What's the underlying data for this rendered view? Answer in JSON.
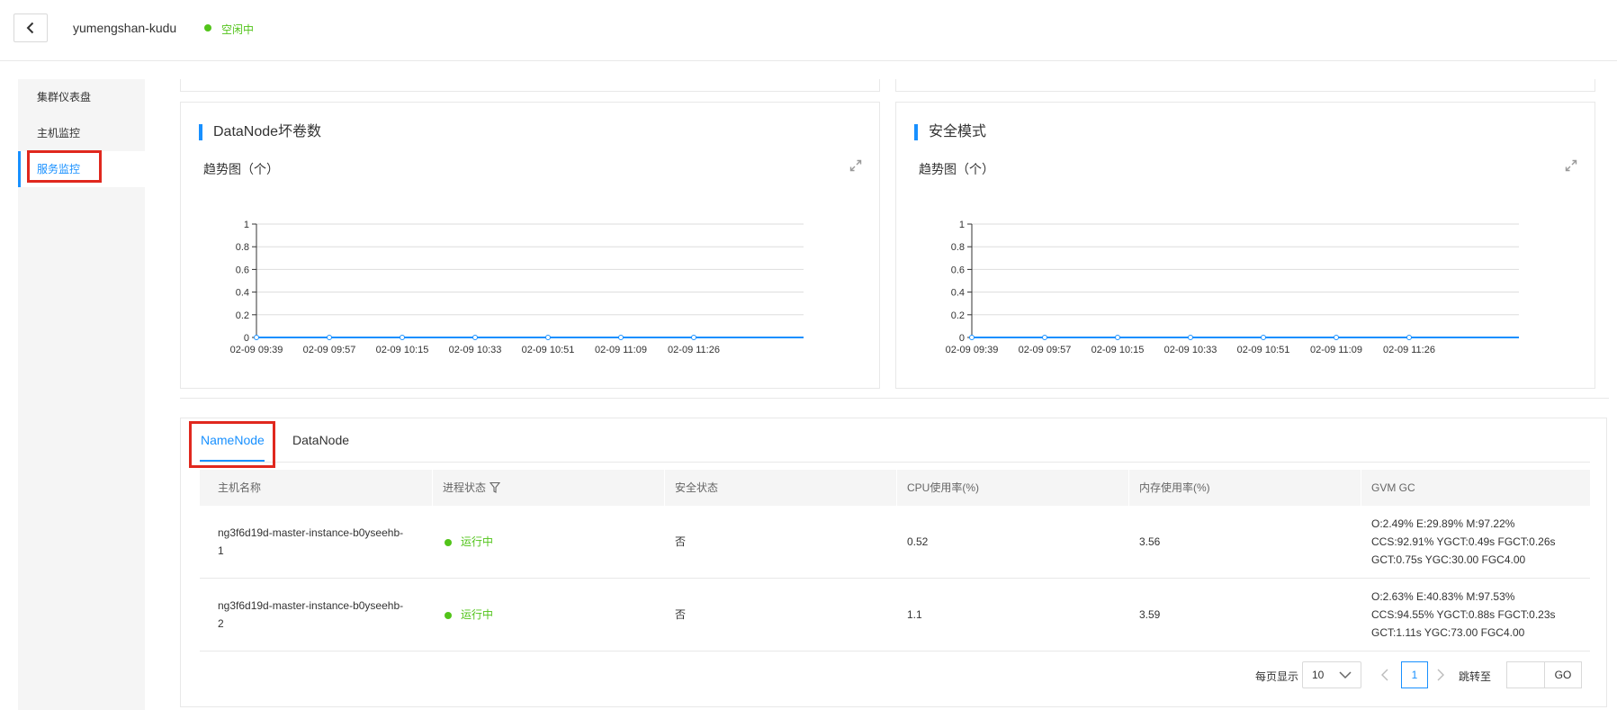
{
  "header": {
    "cluster_name": "yumengshan-kudu",
    "status": "空闲中",
    "status_color": "#52c41a"
  },
  "sidebar": {
    "items": [
      {
        "label": "集群仪表盘"
      },
      {
        "label": "主机监控"
      },
      {
        "label": "服务监控",
        "active": true
      }
    ]
  },
  "panels": [
    {
      "title": "DataNode坏卷数",
      "subtitle": "趋势图（个）"
    },
    {
      "title": "安全模式",
      "subtitle": "趋势图（个）"
    }
  ],
  "chart_data": [
    {
      "type": "line",
      "title": "DataNode坏卷数",
      "x": [
        "02-09 09:39",
        "02-09 09:57",
        "02-09 10:15",
        "02-09 10:33",
        "02-09 10:51",
        "02-09 11:09",
        "02-09 11:26"
      ],
      "series": [
        {
          "values": [
            0,
            0,
            0,
            0,
            0,
            0,
            0
          ]
        }
      ],
      "yticks": [
        "0",
        "0.2",
        "0.4",
        "0.6",
        "0.8",
        "1"
      ],
      "ylim": [
        0,
        1
      ],
      "grid": true,
      "color": "#1890ff"
    },
    {
      "type": "line",
      "title": "安全模式",
      "x": [
        "02-09 09:39",
        "02-09 09:57",
        "02-09 10:15",
        "02-09 10:33",
        "02-09 10:51",
        "02-09 11:09",
        "02-09 11:26"
      ],
      "series": [
        {
          "values": [
            0,
            0,
            0,
            0,
            0,
            0,
            0
          ]
        }
      ],
      "yticks": [
        "0",
        "0.2",
        "0.4",
        "0.6",
        "0.8",
        "1"
      ],
      "ylim": [
        0,
        1
      ],
      "grid": true,
      "color": "#1890ff"
    }
  ],
  "tabs": [
    {
      "label": "NameNode",
      "active": true
    },
    {
      "label": "DataNode"
    }
  ],
  "table": {
    "columns": [
      "主机名称",
      "进程状态",
      "安全状态",
      "CPU使用率(%)",
      "内存使用率(%)",
      "GVM GC"
    ],
    "rows": [
      {
        "host_line1": "ng3f6d19d-master-instance-b0yseehb-",
        "host_line2": "1",
        "process": "运行中",
        "safe": "否",
        "cpu": "0.52",
        "mem": "3.56",
        "gc1": "O:2.49% E:29.89% M:97.22%",
        "gc2": "CCS:92.91% YGCT:0.49s FGCT:0.26s",
        "gc3": "GCT:0.75s YGC:30.00 FGC4.00"
      },
      {
        "host_line1": "ng3f6d19d-master-instance-b0yseehb-",
        "host_line2": "2",
        "process": "运行中",
        "safe": "否",
        "cpu": "1.1",
        "mem": "3.59",
        "gc1": "O:2.63% E:40.83% M:97.53%",
        "gc2": "CCS:94.55% YGCT:0.88s FGCT:0.23s",
        "gc3": "GCT:1.11s YGC:73.00 FGC4.00"
      }
    ]
  },
  "pagination": {
    "page_size_label": "每页显示",
    "page_size": "10",
    "current_page": "1",
    "jump_label": "跳转至",
    "go_label": "GO"
  }
}
